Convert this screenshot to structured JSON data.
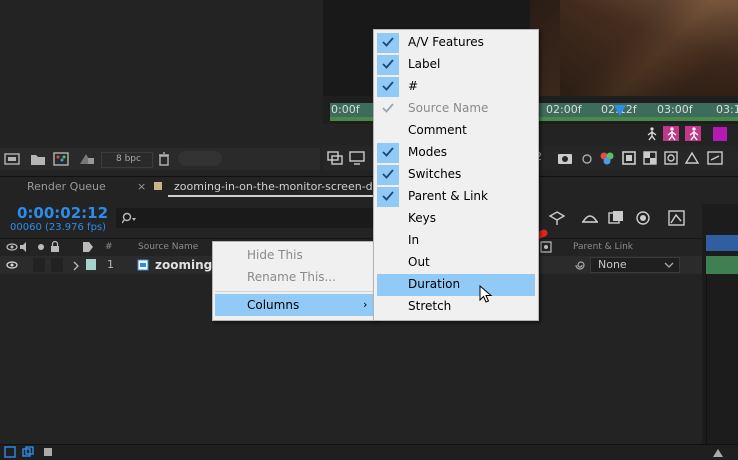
{
  "colors": {
    "accent_blue": "#2d8ceb",
    "menu_bg": "#f0f0f0",
    "menu_highlight": "#91c9f7",
    "check_disabled": "#9aa6b0",
    "annotation_red": "#e0261f",
    "layer_label": "#a7d2cc"
  },
  "project_panel": {
    "bpc_label": "8 bpc"
  },
  "viewer": {
    "ruler_ticks": [
      "0:00f",
      "02:00f",
      "02:12f",
      "03:00f",
      "03:1"
    ],
    "zoom_value": "2"
  },
  "tabs": {
    "render_queue": "Render Queue",
    "close_glyph": "×",
    "composition": "zooming-in-on-the-monitor-screen-displ"
  },
  "timeline": {
    "timecode": "0:00:02:12",
    "frames": "00060 (23.976 fps)",
    "search_placeholder": "",
    "headers": {
      "hash": "#",
      "source_name": "Source Name",
      "parent_link": "Parent & Link"
    },
    "layer": {
      "number": "1",
      "name": "zooming.",
      "parent": "None"
    }
  },
  "context_menu": {
    "items": [
      {
        "label": "Hide This",
        "enabled": false
      },
      {
        "label": "Rename This...",
        "enabled": false
      },
      {
        "label": "Columns",
        "enabled": true,
        "highlighted": true,
        "has_submenu": true
      }
    ],
    "submenu_arrow": "›"
  },
  "columns_submenu": {
    "items": [
      {
        "label": "A/V Features",
        "checked": true,
        "enabled": true
      },
      {
        "label": "Label",
        "checked": true,
        "enabled": true
      },
      {
        "label": "#",
        "checked": true,
        "enabled": true
      },
      {
        "label": "Source Name",
        "checked": true,
        "enabled": false
      },
      {
        "label": "Comment",
        "checked": false,
        "enabled": true
      },
      {
        "label": "Modes",
        "checked": true,
        "enabled": true
      },
      {
        "label": "Switches",
        "checked": true,
        "enabled": true
      },
      {
        "label": "Parent & Link",
        "checked": true,
        "enabled": true
      },
      {
        "label": "Keys",
        "checked": false,
        "enabled": true
      },
      {
        "label": "In",
        "checked": false,
        "enabled": true
      },
      {
        "label": "Out",
        "checked": false,
        "enabled": true
      },
      {
        "label": "Duration",
        "checked": false,
        "enabled": true,
        "highlighted": true
      },
      {
        "label": "Stretch",
        "checked": false,
        "enabled": true
      }
    ]
  }
}
